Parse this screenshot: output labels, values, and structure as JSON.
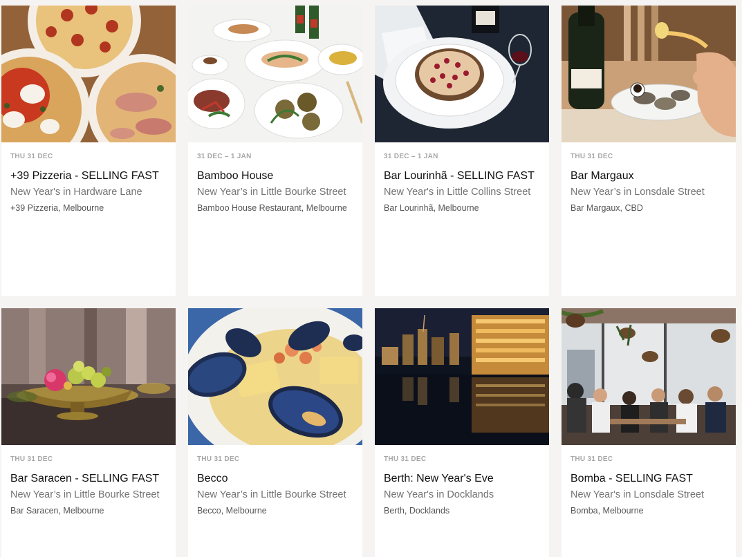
{
  "events": [
    {
      "date": "THU 31 DEC",
      "title": "+39 Pizzeria - SELLING FAST",
      "subtitle": "New Year's in Hardware Lane",
      "venue": "+39 Pizzeria, Melbourne",
      "image": "pizza-photo"
    },
    {
      "date": "31 DEC – 1 JAN",
      "title": "Bamboo House",
      "subtitle": "New Year’s in Little Bourke Street",
      "venue": "Bamboo House Restaurant, Melbourne",
      "image": "chinese-banquet-photo"
    },
    {
      "date": "31 DEC – 1 JAN",
      "title": "Bar Lourinhã - SELLING FAST",
      "subtitle": "New Year's in Little Collins Street",
      "venue": "Bar Lourinhã, Melbourne",
      "image": "dessert-wine-photo"
    },
    {
      "date": "THU 31 DEC",
      "title": "Bar Margaux",
      "subtitle": "New Year’s in Lonsdale Street",
      "venue": "Bar Margaux, CBD",
      "image": "oysters-champagne-photo"
    },
    {
      "date": "THU 31 DEC",
      "title": "Bar Saracen - SELLING FAST",
      "subtitle": "New Year’s in Little Bourke Street",
      "venue": "Bar Saracen, Melbourne",
      "image": "vegetable-dish-photo"
    },
    {
      "date": "THU 31 DEC",
      "title": "Becco",
      "subtitle": "New Year’s in Little Bourke Street",
      "venue": "Becco, Melbourne",
      "image": "mussels-pasta-photo"
    },
    {
      "date": "THU 31 DEC",
      "title": "Berth: New Year's Eve",
      "subtitle": "New Year's in Docklands",
      "venue": "Berth, Docklands",
      "image": "docklands-night-photo"
    },
    {
      "date": "THU 31 DEC",
      "title": "Bomba - SELLING FAST",
      "subtitle": "New Year's in Lonsdale Street",
      "venue": "Bomba, Melbourne",
      "image": "rooftop-diners-photo"
    }
  ]
}
